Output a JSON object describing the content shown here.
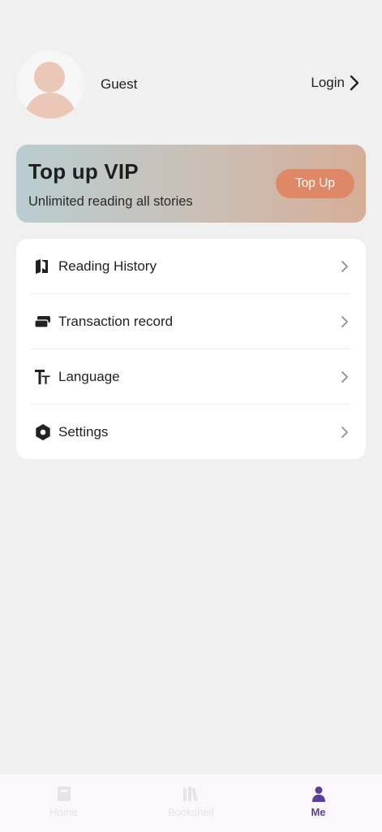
{
  "profile": {
    "username": "Guest",
    "login_label": "Login"
  },
  "vip": {
    "title": "Top up VIP",
    "subtitle": "Unlimited reading all stories",
    "button_label": "Top Up",
    "button_color": "#de8868"
  },
  "menu": {
    "items": [
      {
        "label": "Reading History",
        "icon": "book-icon"
      },
      {
        "label": "Transaction record",
        "icon": "tickets-icon"
      },
      {
        "label": "Language",
        "icon": "text-size-icon"
      },
      {
        "label": "Settings",
        "icon": "hexagon-settings-icon"
      }
    ]
  },
  "tabbar": {
    "tabs": [
      {
        "label": "Home",
        "icon": "home-book-icon",
        "active": false
      },
      {
        "label": "Bookshelf",
        "icon": "bookshelf-icon",
        "active": false
      },
      {
        "label": "Me",
        "icon": "person-icon",
        "active": true
      }
    ],
    "active_color": "#5a3f9a",
    "inactive_color": "#e9e3e9"
  }
}
